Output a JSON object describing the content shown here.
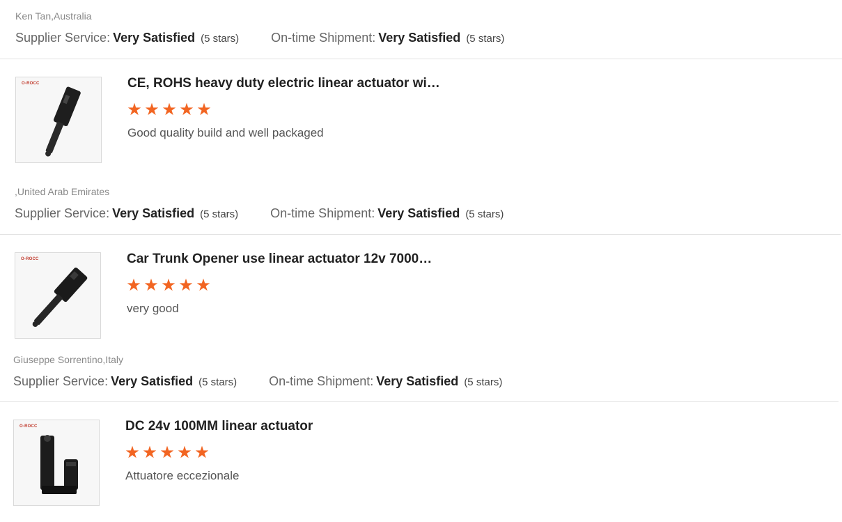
{
  "labels": {
    "supplier_service": "Supplier Service:",
    "ontime_shipment": "On-time Shipment:"
  },
  "colors": {
    "star": "#f26522",
    "divider": "#e3e3e3",
    "brand": "#c0392b"
  },
  "reviews": [
    {
      "reviewer": "Ken Tan,Australia",
      "supplier_service_value": "Very Satisfied",
      "supplier_service_stars": "(5 stars)",
      "shipment_value": "Very Satisfied",
      "shipment_stars": "(5 stars)"
    },
    {
      "product_title": "CE, ROHS heavy duty electric linear actuator wi…",
      "rating": 5,
      "star_icon": "star-icon",
      "comment": "Good quality build and well packaged",
      "brand_mark": "O-ROCC",
      "reviewer": ",United Arab Emirates",
      "supplier_service_value": "Very Satisfied",
      "supplier_service_stars": "(5 stars)",
      "shipment_value": "Very Satisfied",
      "shipment_stars": "(5 stars)"
    },
    {
      "product_title": "Car Trunk Opener use linear actuator 12v 7000…",
      "rating": 5,
      "star_icon": "star-icon",
      "comment": "very good",
      "brand_mark": "O-ROCC",
      "reviewer": "Giuseppe Sorrentino,Italy",
      "supplier_service_value": "Very Satisfied",
      "supplier_service_stars": "(5 stars)",
      "shipment_value": "Very Satisfied",
      "shipment_stars": "(5 stars)"
    },
    {
      "product_title": "DC 24v 100MM linear actuator",
      "rating": 5,
      "star_icon": "star-icon",
      "comment": "Attuatore eccezionale",
      "brand_mark": "O-ROCC"
    }
  ]
}
